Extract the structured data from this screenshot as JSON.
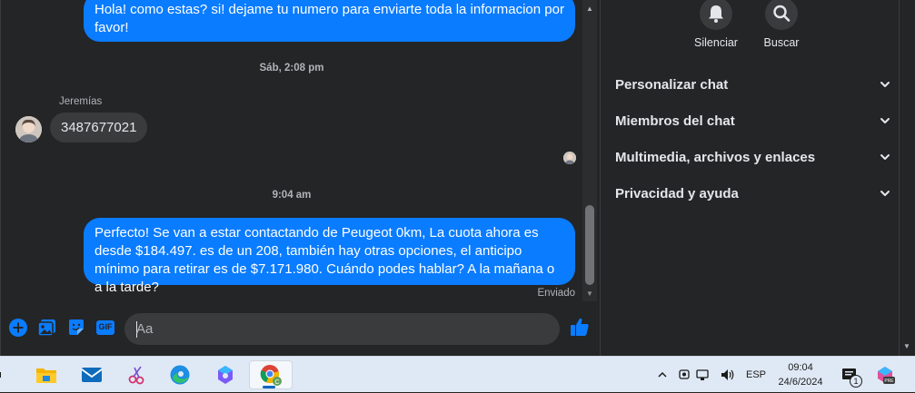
{
  "chat": {
    "messages": [
      {
        "text": "Hola! como estas? si! dejame tu numero para enviarte toda la informacion por favor!"
      },
      {
        "timestamp": "Sáb, 2:08 pm"
      },
      {
        "sender": "Jeremías",
        "text": "3487677021"
      },
      {
        "timestamp": "9:04 am"
      },
      {
        "text": "Perfecto!  Se van a estar contactando de Peugeot 0km, La cuota ahora es desde $184.497. es de un 208, también hay otras opciones, el anticipo mínimo para retirar es de $7.171.980. Cuándo podes hablar? A la mañana o a la tarde?"
      }
    ],
    "sent_status": "Enviado"
  },
  "composer": {
    "placeholder": "Aa",
    "gif_label": "GIF"
  },
  "panel": {
    "actions": [
      {
        "label": "Silenciar",
        "icon": "bell-icon"
      },
      {
        "label": "Buscar",
        "icon": "search-icon"
      }
    ],
    "sections": [
      {
        "label": "Personalizar chat"
      },
      {
        "label": "Miembros del chat"
      },
      {
        "label": "Multimedia, archivos y enlaces"
      },
      {
        "label": "Privacidad y ayuda"
      }
    ]
  },
  "taskbar": {
    "language": "ESP",
    "time": "09:04",
    "date": "24/6/2024",
    "notification_count": "1",
    "apps": [
      "file-explorer-icon",
      "mail-icon",
      "snipping-tool-icon",
      "edge-icon",
      "copilot-icon",
      "chrome-icon"
    ]
  },
  "colors": {
    "outgoing_bubble": "#0a7cff",
    "incoming_bubble": "#3a3b3c",
    "background": "#242526",
    "accent": "#0a7cff"
  }
}
